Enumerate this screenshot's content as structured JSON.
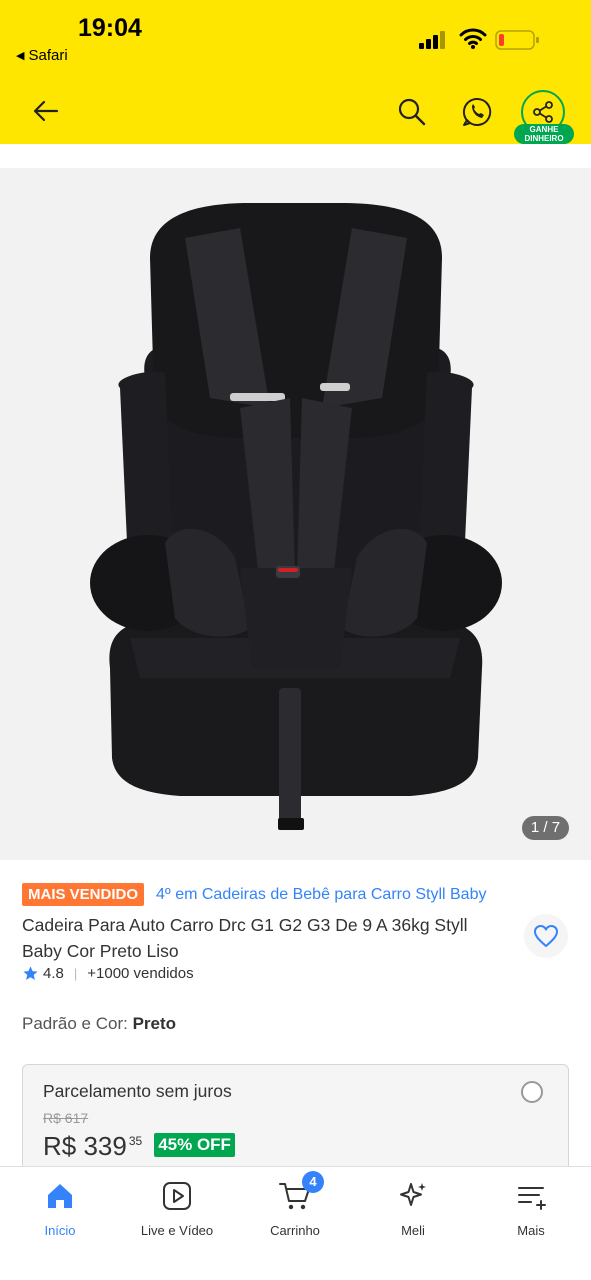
{
  "status_bar": {
    "time": "19:04",
    "back_app": "Safari",
    "battery_color": "#ff3b30"
  },
  "header": {
    "background": "#FFE600",
    "share_badge": "GANHE DINHEIRO",
    "icons": [
      "back-arrow-icon",
      "search-icon",
      "whatsapp-icon",
      "share-icon"
    ]
  },
  "gallery": {
    "counter": "1 / 7",
    "image_alt": "black child car seat"
  },
  "product": {
    "badge": "MAIS VENDIDO",
    "ranking": "4º em Cadeiras de Bebê para Carro Styll Baby",
    "title": "Cadeira Para Auto Carro Drc G1 G2 G3 De 9 A 36kg Styll Baby Cor Preto Liso",
    "rating": "4.8",
    "sold": "+1000 vendidos",
    "variant_label": "Padrão e Cor:",
    "variant_value": "Preto"
  },
  "payment": {
    "title": "Parcelamento sem juros",
    "old_price": "R$ 617",
    "price": "R$ 339",
    "cents": "35",
    "discount": "45% OFF"
  },
  "tabbar": {
    "tabs": [
      {
        "label": "Início",
        "icon": "home-icon",
        "active": true
      },
      {
        "label": "Live e Vídeo",
        "icon": "play-icon",
        "active": false
      },
      {
        "label": "Carrinho",
        "icon": "cart-icon",
        "active": false
      },
      {
        "label": "Meli",
        "icon": "sparkle-icon",
        "active": false
      },
      {
        "label": "Mais",
        "icon": "menu-icon",
        "active": false
      }
    ],
    "cart_count": "4"
  },
  "colors": {
    "accent_blue": "#3483fa",
    "green": "#00a650",
    "orange_badge": "#ff7733"
  }
}
